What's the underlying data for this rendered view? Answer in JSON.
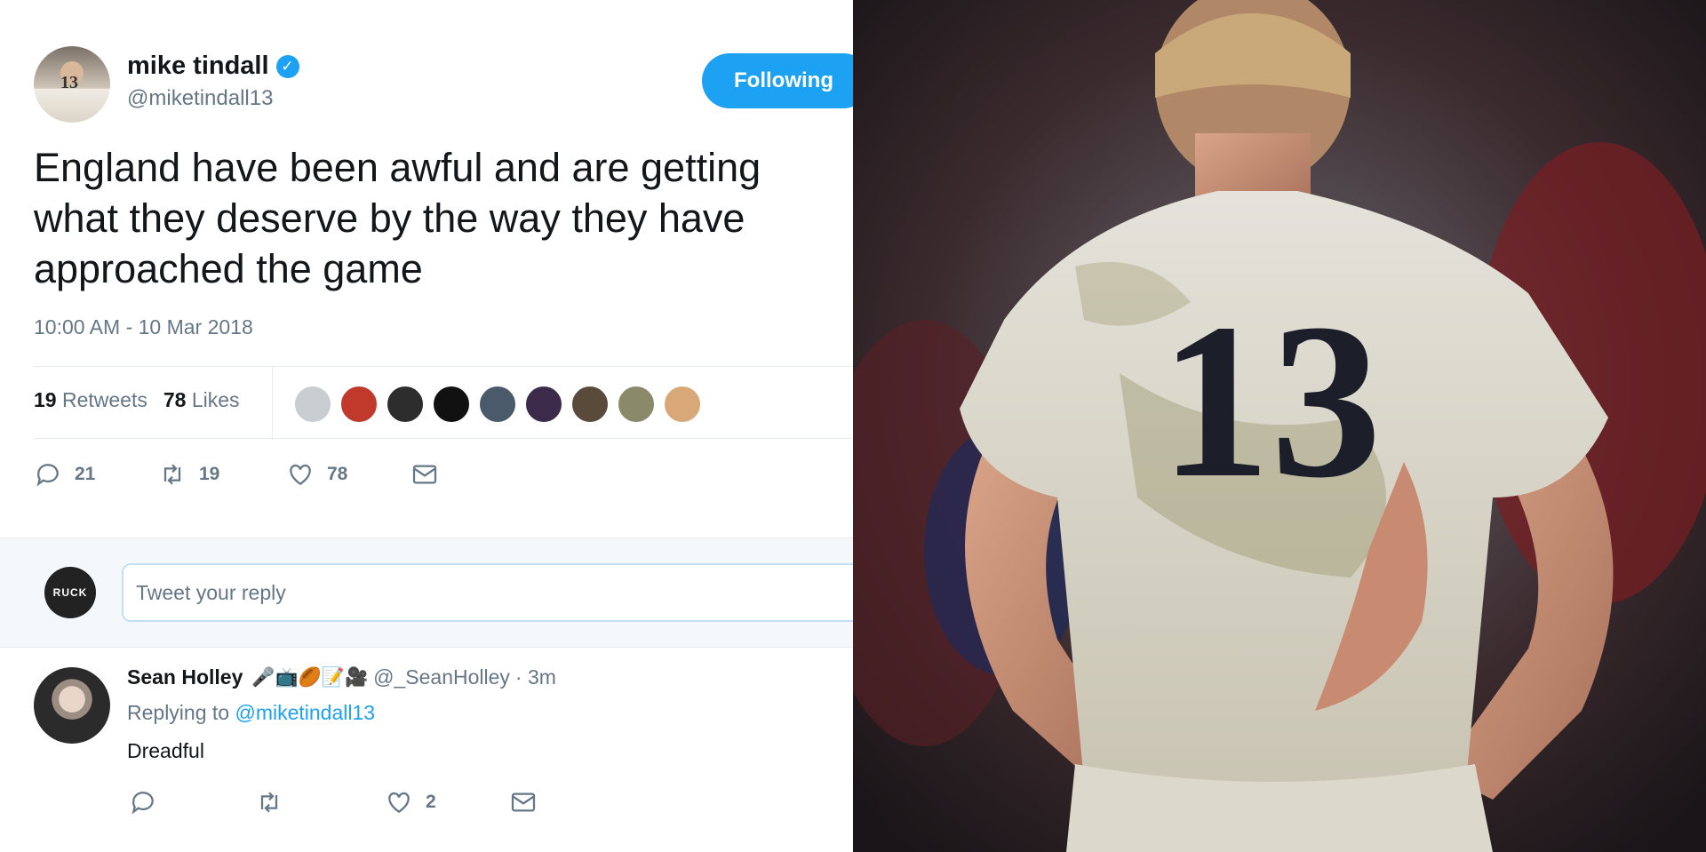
{
  "tweet": {
    "author_name": "mike tindall",
    "verified_mark": "✓",
    "author_handle": "@miketindall13",
    "avatar_number": "13",
    "follow_label": "Following",
    "text": "England have been awful and are getting what they deserve by the way they have approached the game",
    "timestamp": "10:00 AM - 10 Mar 2018",
    "retweets_count": "19",
    "retweets_label": "Retweets",
    "likes_count": "78",
    "likes_label": "Likes",
    "likers": [
      "#c8cdd2",
      "#c0392b",
      "#2d2d2d",
      "#111111",
      "#4a5a6a",
      "#3b2a4a",
      "#5a4a3a",
      "#8a8a6a",
      "#d8a878"
    ],
    "actions": {
      "reply_count": "21",
      "retweet_count": "19",
      "like_count": "78"
    }
  },
  "reply_composer": {
    "avatar_text": "RUCK",
    "placeholder": "Tweet your reply"
  },
  "reply": {
    "name": "Sean Holley",
    "emojis": "🎤📺🏉📝🎥",
    "handle": "@_SeanHolley",
    "time": "· 3m",
    "replying_prefix": "Replying to",
    "replying_to": "@miketindall13",
    "text": "Dreadful",
    "like_count": "2"
  },
  "photo": {
    "jersey_number": "13"
  },
  "colors": {
    "accent": "#1da1f2",
    "muted": "#657786",
    "text": "#14171a"
  }
}
